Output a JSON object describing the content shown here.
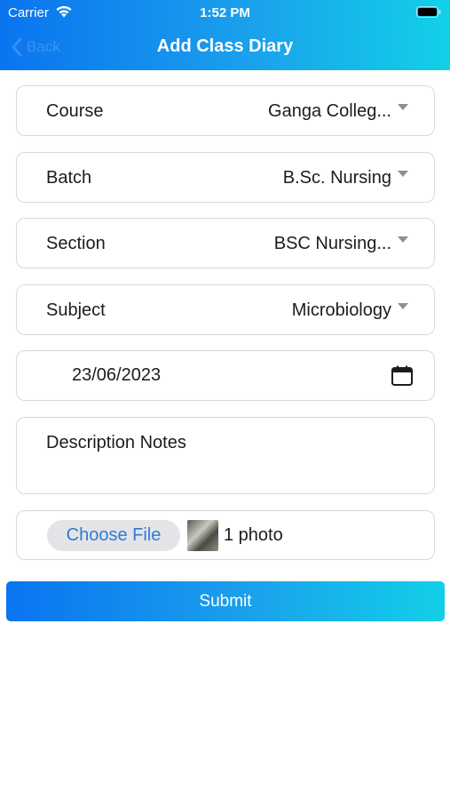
{
  "status_bar": {
    "carrier": "Carrier",
    "time": "1:52 PM"
  },
  "nav": {
    "back_label": "Back",
    "title": "Add Class Diary"
  },
  "form": {
    "fields": [
      {
        "label": "Course",
        "value": "Ganga Colleg..."
      },
      {
        "label": "Batch",
        "value": "B.Sc. Nursing"
      },
      {
        "label": "Section",
        "value": "BSC Nursing..."
      },
      {
        "label": "Subject",
        "value": "Microbiology"
      }
    ],
    "date": "23/06/2023",
    "description_placeholder": "Description  Notes",
    "choose_file_label": "Choose File",
    "file_count": "1 photo",
    "submit_label": "Submit"
  },
  "colors": {
    "accent_start": "#0a74f0",
    "accent_end": "#12d0e8",
    "link": "#2e7bd6"
  },
  "icons": [
    "wifi-icon",
    "battery-icon",
    "back-chevron-icon",
    "dropdown-caret-icon",
    "calendar-icon"
  ]
}
